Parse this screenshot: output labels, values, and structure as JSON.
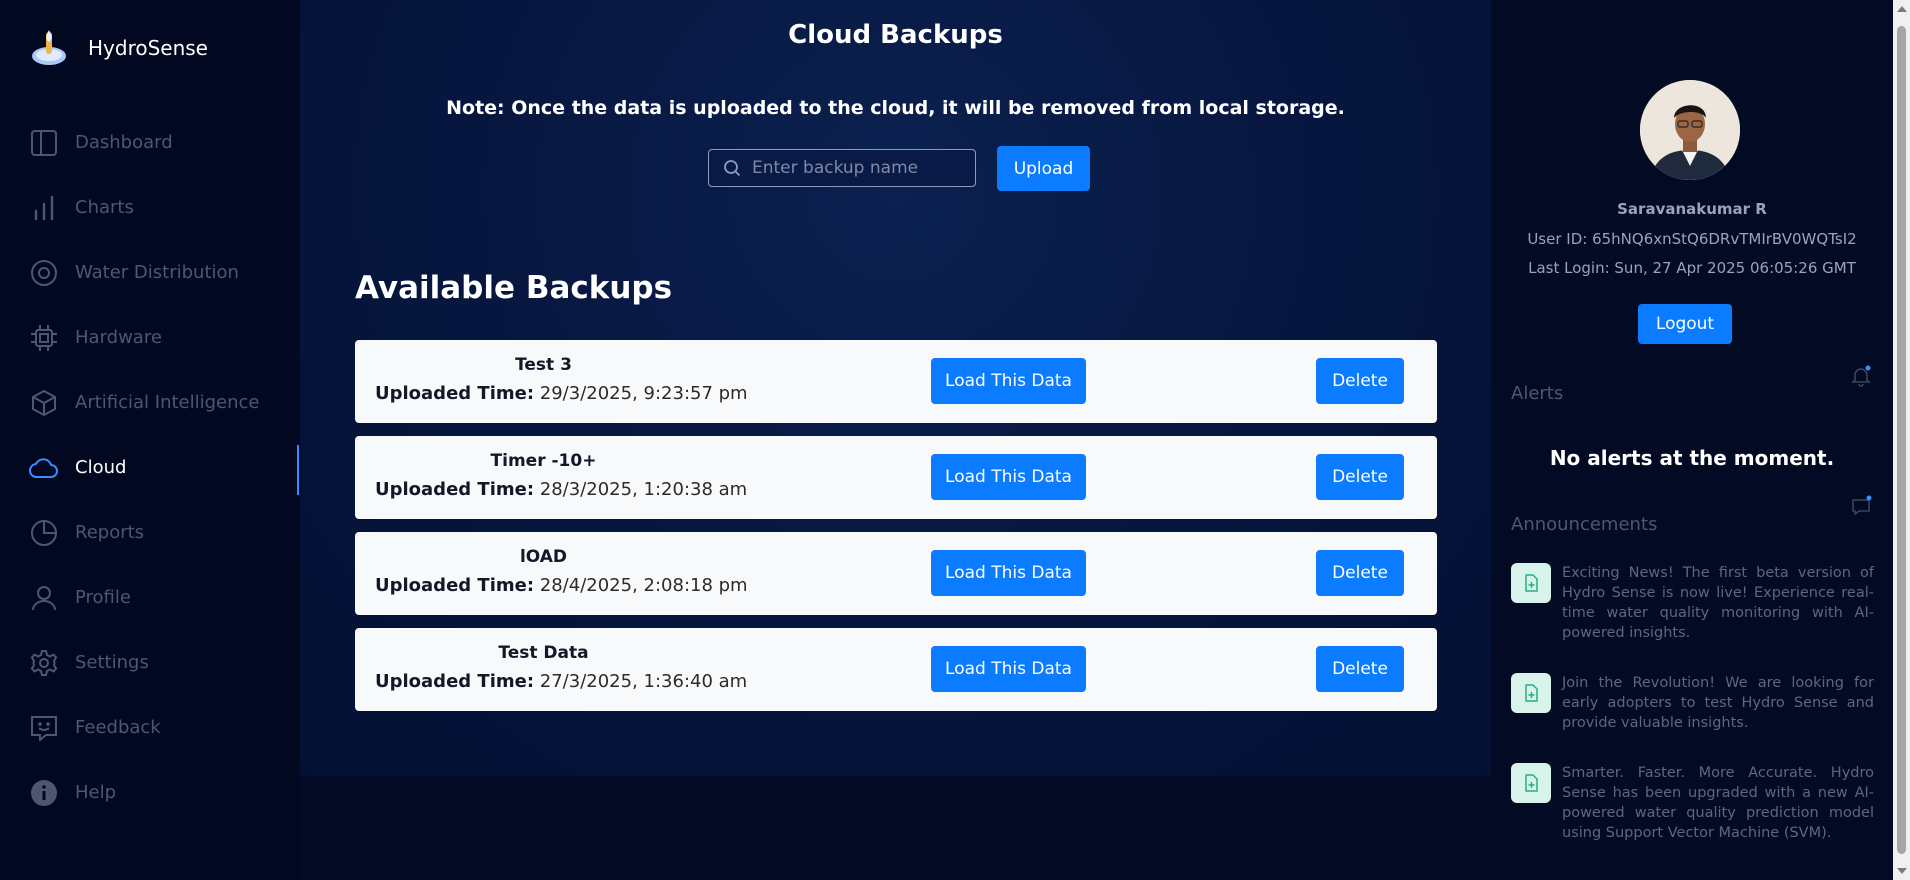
{
  "app": {
    "name": "HydroSense"
  },
  "sidebar": {
    "items": [
      {
        "label": "Dashboard",
        "icon": "dashboard-icon"
      },
      {
        "label": "Charts",
        "icon": "bar-chart-icon"
      },
      {
        "label": "Water Distribution",
        "icon": "target-icon"
      },
      {
        "label": "Hardware",
        "icon": "cpu-chip-icon"
      },
      {
        "label": "Artificial Intelligence",
        "icon": "cube-icon"
      },
      {
        "label": "Cloud",
        "icon": "cloud-icon",
        "active": true
      },
      {
        "label": "Reports",
        "icon": "pie-chart-icon"
      },
      {
        "label": "Profile",
        "icon": "user-icon"
      },
      {
        "label": "Settings",
        "icon": "gear-icon"
      },
      {
        "label": "Feedback",
        "icon": "feedback-icon"
      },
      {
        "label": "Help",
        "icon": "info-icon"
      }
    ]
  },
  "main": {
    "title": "Cloud Backups",
    "note": "Note: Once the data is uploaded to the cloud, it will be removed from local storage.",
    "search": {
      "placeholder": "Enter backup name",
      "value": ""
    },
    "upload_label": "Upload",
    "section_title": "Available Backups",
    "time_label": "Uploaded Time:",
    "load_label": "Load This Data",
    "delete_label": "Delete",
    "backups": [
      {
        "name": "Test 3",
        "time": "29/3/2025, 9:23:57 pm"
      },
      {
        "name": "Timer -10+",
        "time": "28/3/2025, 1:20:38 am"
      },
      {
        "name": "lOAD",
        "time": "28/4/2025, 2:08:18 pm"
      },
      {
        "name": "Test Data",
        "time": "27/3/2025, 1:36:40 am"
      }
    ]
  },
  "profile": {
    "name": "Saravanakumar R",
    "user_id": "User ID: 65hNQ6xnStQ6DRvTMIrBV0WQTsI2",
    "last_login": "Last Login: Sun, 27 Apr 2025 06:05:26 GMT",
    "logout_label": "Logout"
  },
  "alerts": {
    "title": "Alerts",
    "empty_text": "No alerts at the moment."
  },
  "announcements": {
    "title": "Announcements",
    "items": [
      "Exciting News! The first beta version of Hydro Sense is now live! Experience real-time water quality monitoring with AI-powered insights.",
      "Join the Revolution! We are looking for early adopters to test Hydro Sense and provide valuable insights.",
      "Smarter. Faster. More Accurate. Hydro Sense has been upgraded with a new AI-powered water quality prediction model using Support Vector Machine (SVM)."
    ]
  },
  "colors": {
    "accent": "#0b7bff",
    "background": "#020a24",
    "muted_text": "#4d5870"
  }
}
